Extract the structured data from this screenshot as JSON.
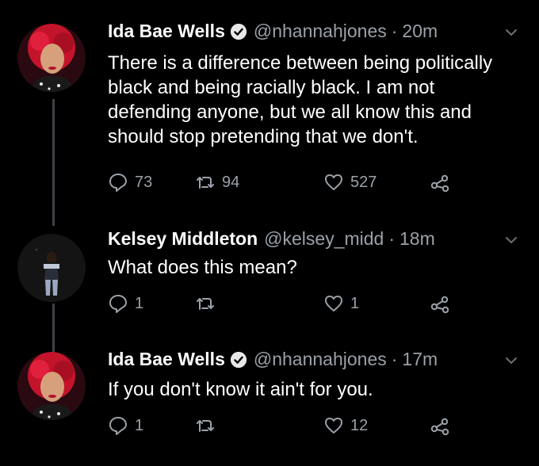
{
  "tweets": [
    {
      "name": "Ida Bae Wells",
      "handle": "@nhannahjones",
      "separator": "·",
      "time": "20m",
      "text": "There is a difference between being politically black and being racially black. I am not defending anyone, but we all know this and should stop pretending that we don't.",
      "replies": "73",
      "retweets": "94",
      "likes": "527"
    },
    {
      "name": "Kelsey Middleton",
      "handle": "@kelsey_midd",
      "separator": "·",
      "time": "18m",
      "text": "What does this mean?",
      "replies": "1",
      "retweets": "",
      "likes": "1"
    },
    {
      "name": "Ida Bae Wells",
      "handle": "@nhannahjones",
      "separator": "·",
      "time": "17m",
      "text": "If you don't know it ain't for you.",
      "replies": "1",
      "retweets": "",
      "likes": "12"
    }
  ],
  "icons": {
    "verified": "verified-badge-icon",
    "reply": "reply-icon",
    "retweet": "retweet-icon",
    "like": "heart-icon",
    "share": "share-icon",
    "more": "chevron-down-icon"
  },
  "colors": {
    "background": "#000000",
    "text": "#ffffff",
    "muted": "#9aa1a8",
    "thread_line": "#3d4148"
  }
}
